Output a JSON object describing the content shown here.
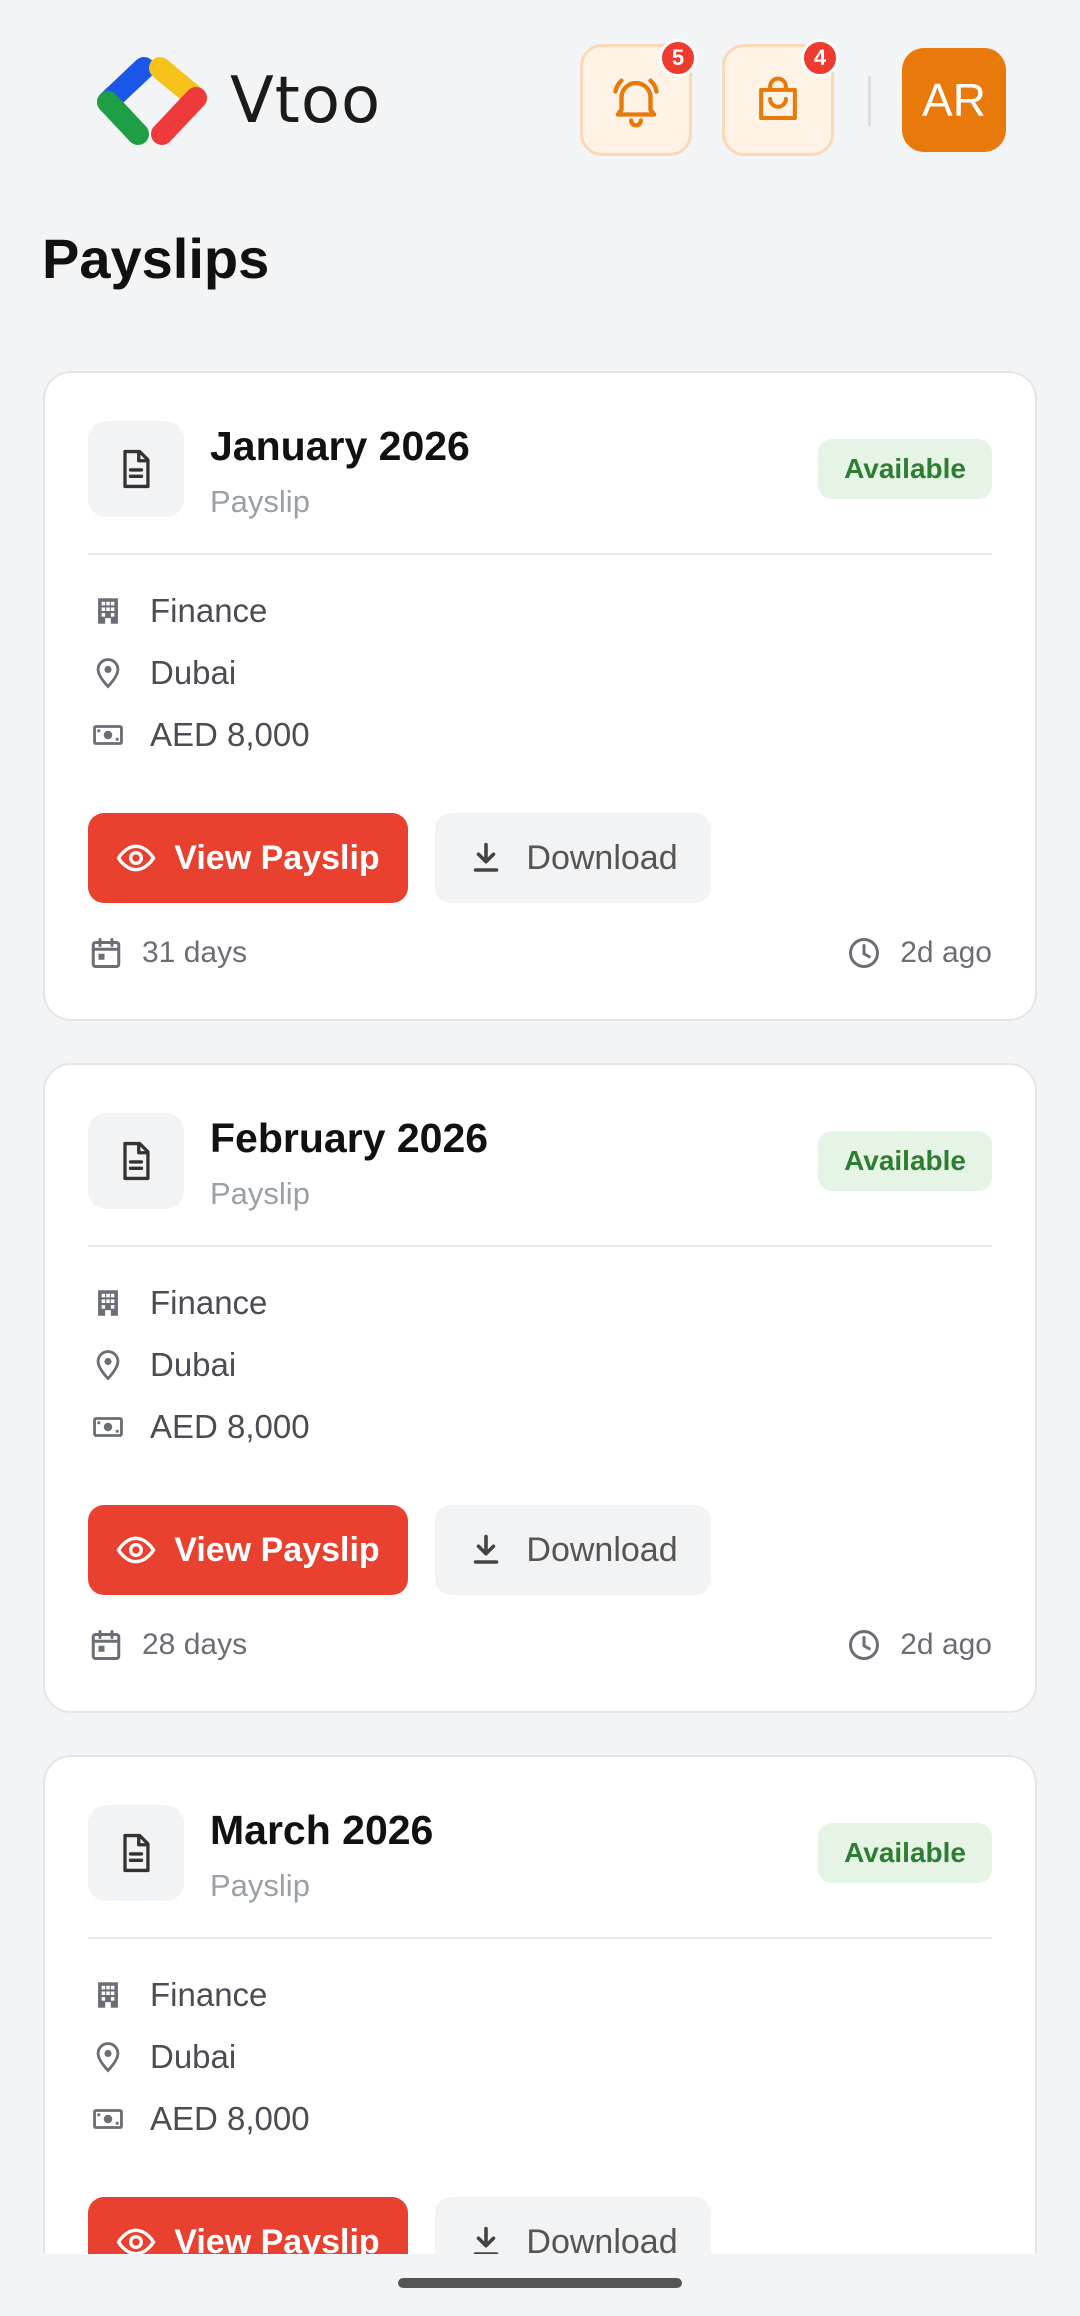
{
  "app": {
    "name": "Vtoo"
  },
  "header": {
    "notifications_count": "5",
    "cart_count": "4",
    "avatar_initials": "AR",
    "accent": "#e87a0c"
  },
  "page": {
    "title": "Payslips"
  },
  "payslips": [
    {
      "title": "January 2026",
      "subtitle": "Payslip",
      "status": "Available",
      "department": "Finance",
      "location": "Dubai",
      "amount": "AED 8,000",
      "view_label": "View Payslip",
      "download_label": "Download",
      "duration": "31 days",
      "updated": "2d ago"
    },
    {
      "title": "February 2026",
      "subtitle": "Payslip",
      "status": "Available",
      "department": "Finance",
      "location": "Dubai",
      "amount": "AED 8,000",
      "view_label": "View Payslip",
      "download_label": "Download",
      "duration": "28 days",
      "updated": "2d ago"
    },
    {
      "title": "March 2026",
      "subtitle": "Payslip",
      "status": "Available",
      "department": "Finance",
      "location": "Dubai",
      "amount": "AED 8,000",
      "view_label": "View Payslip",
      "download_label": "Download",
      "duration": "",
      "updated": ""
    }
  ],
  "icons": {
    "header": [
      "bell-icon",
      "shopping-bag-icon"
    ],
    "card": [
      "document-icon",
      "building-icon",
      "location-pin-icon",
      "money-icon",
      "eye-icon",
      "download-icon",
      "calendar-icon",
      "clock-icon"
    ]
  },
  "colors": {
    "primary_button": "#e8412f",
    "status_bg": "#e6f4e6",
    "status_text": "#2e7d32",
    "badge": "#ef3b2f"
  }
}
